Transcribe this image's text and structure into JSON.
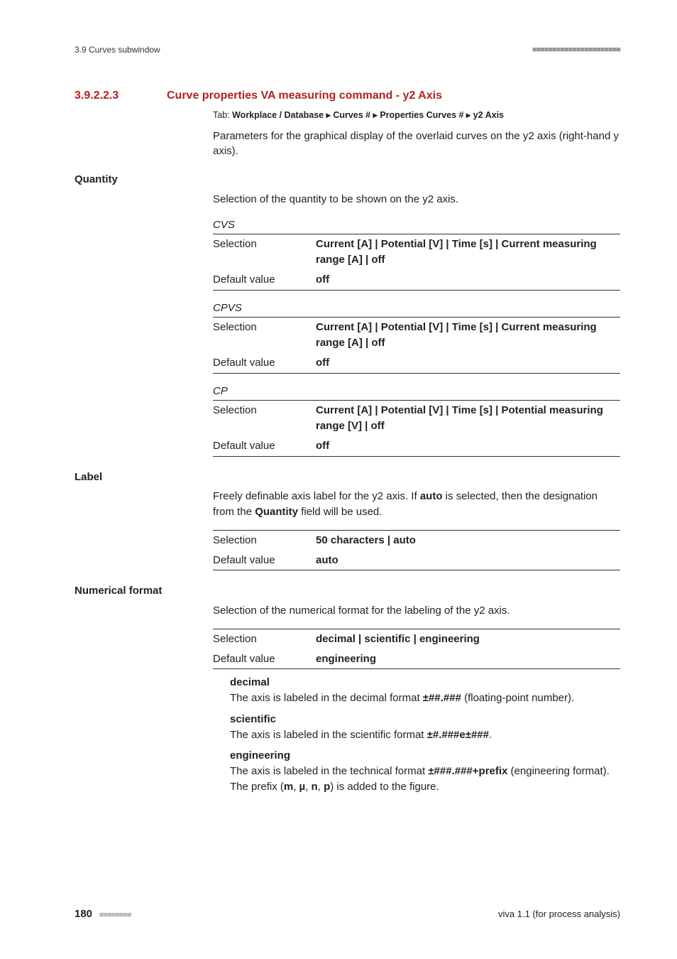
{
  "header": {
    "left": "3.9 Curves subwindow",
    "right": "■■■■■■■■■■■■■■■■■■■■■■"
  },
  "section": {
    "number": "3.9.2.2.3",
    "title": "Curve properties VA measuring command - y2 Axis"
  },
  "tab": {
    "prefix": "Tab: ",
    "path": "Workplace / Database ▸ Curves # ▸ Properties Curves # ▸ y2 Axis"
  },
  "intro": "Parameters for the graphical display of the overlaid curves on the y2 axis (right-hand y axis).",
  "quantity": {
    "heading": "Quantity",
    "desc": "Selection of the quantity to be shown on the y2 axis.",
    "groups": [
      {
        "name": "CVS",
        "rows": [
          {
            "label": "Selection",
            "value": "Current [A] | Potential [V] | Time [s] | Current measuring range [A] | off"
          },
          {
            "label": "Default value",
            "value": "off"
          }
        ]
      },
      {
        "name": "CPVS",
        "rows": [
          {
            "label": "Selection",
            "value": "Current [A] | Potential [V] | Time [s] | Current measuring range [A] | off"
          },
          {
            "label": "Default value",
            "value": "off"
          }
        ]
      },
      {
        "name": "CP",
        "rows": [
          {
            "label": "Selection",
            "value": "Current [A] | Potential [V] | Time [s] | Potential measuring range [V] | off"
          },
          {
            "label": "Default value",
            "value": "off"
          }
        ]
      }
    ]
  },
  "label": {
    "heading": "Label",
    "desc_pre": "Freely definable axis label for the y2 axis. If ",
    "desc_bold1": "auto",
    "desc_mid": " is selected, then the designation from the ",
    "desc_bold2": "Quantity",
    "desc_post": " field will be used.",
    "rows": [
      {
        "label": "Selection",
        "value": "50 characters | auto"
      },
      {
        "label": "Default value",
        "value": "auto"
      }
    ]
  },
  "numformat": {
    "heading": "Numerical format",
    "desc": "Selection of the numerical format for the labeling of the y2 axis.",
    "rows": [
      {
        "label": "Selection",
        "value": "decimal | scientific | engineering"
      },
      {
        "label": "Default value",
        "value": "engineering"
      }
    ],
    "defs": [
      {
        "title": "decimal",
        "pre": "The axis is labeled in the decimal format ",
        "fmt": "±##.###",
        "post": " (floating-point number)."
      },
      {
        "title": "scientific",
        "pre": "The axis is labeled in the scientific format ",
        "fmt": "±#.###e±###",
        "post": "."
      },
      {
        "title": "engineering",
        "pre": "The axis is labeled in the technical format ",
        "fmt": "±###.###+prefix",
        "post_pre": " (engineering format). The prefix (",
        "p1": "m",
        "c1": ", ",
        "p2": "µ",
        "c2": ", ",
        "p3": "n",
        "c3": ", ",
        "p4": "p",
        "post_post": ") is added to the figure."
      }
    ]
  },
  "footer": {
    "page": "180",
    "dashes": "■■■■■■■■",
    "right": "viva 1.1 (for process analysis)"
  }
}
